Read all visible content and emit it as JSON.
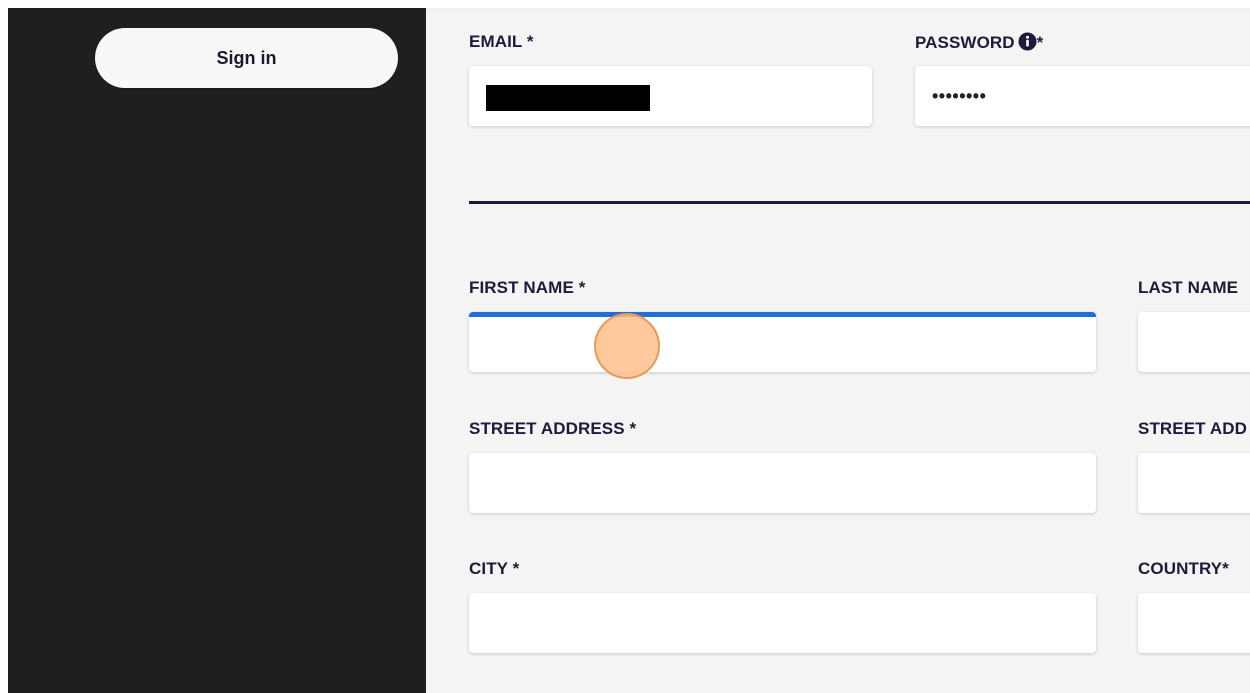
{
  "sidebar": {
    "signin_label": "Sign in"
  },
  "form": {
    "email": {
      "label": "EMAIL *",
      "value_redacted": true
    },
    "password": {
      "label_text": "PASSWORD",
      "label_suffix": "*",
      "value_masked": "••••••••",
      "info_icon": "info-circle-icon"
    },
    "first_name": {
      "label": "FIRST NAME *",
      "value": ""
    },
    "last_name": {
      "label": "LAST NAME",
      "value": ""
    },
    "street_address": {
      "label": "STREET ADDRESS *",
      "value": ""
    },
    "street_address_2": {
      "label": "STREET ADD",
      "value": ""
    },
    "city": {
      "label": "CITY *",
      "value": ""
    },
    "country": {
      "label": "COUNTRY*",
      "value": ""
    }
  },
  "colors": {
    "sidebar_bg": "#1f1f1f",
    "main_bg": "#f4f4f4",
    "label_text": "#1e1b3a",
    "focus_accent": "#1f6fd6",
    "cursor_marker": "#ffbe8c"
  }
}
